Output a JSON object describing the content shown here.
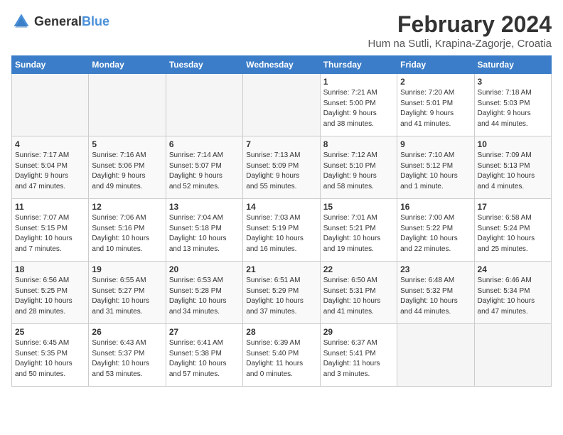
{
  "logo": {
    "general": "General",
    "blue": "Blue"
  },
  "title": "February 2024",
  "subtitle": "Hum na Sutli, Krapina-Zagorje, Croatia",
  "days_of_week": [
    "Sunday",
    "Monday",
    "Tuesday",
    "Wednesday",
    "Thursday",
    "Friday",
    "Saturday"
  ],
  "weeks": [
    [
      {
        "day": "",
        "info": ""
      },
      {
        "day": "",
        "info": ""
      },
      {
        "day": "",
        "info": ""
      },
      {
        "day": "",
        "info": ""
      },
      {
        "day": "1",
        "info": "Sunrise: 7:21 AM\nSunset: 5:00 PM\nDaylight: 9 hours\nand 38 minutes."
      },
      {
        "day": "2",
        "info": "Sunrise: 7:20 AM\nSunset: 5:01 PM\nDaylight: 9 hours\nand 41 minutes."
      },
      {
        "day": "3",
        "info": "Sunrise: 7:18 AM\nSunset: 5:03 PM\nDaylight: 9 hours\nand 44 minutes."
      }
    ],
    [
      {
        "day": "4",
        "info": "Sunrise: 7:17 AM\nSunset: 5:04 PM\nDaylight: 9 hours\nand 47 minutes."
      },
      {
        "day": "5",
        "info": "Sunrise: 7:16 AM\nSunset: 5:06 PM\nDaylight: 9 hours\nand 49 minutes."
      },
      {
        "day": "6",
        "info": "Sunrise: 7:14 AM\nSunset: 5:07 PM\nDaylight: 9 hours\nand 52 minutes."
      },
      {
        "day": "7",
        "info": "Sunrise: 7:13 AM\nSunset: 5:09 PM\nDaylight: 9 hours\nand 55 minutes."
      },
      {
        "day": "8",
        "info": "Sunrise: 7:12 AM\nSunset: 5:10 PM\nDaylight: 9 hours\nand 58 minutes."
      },
      {
        "day": "9",
        "info": "Sunrise: 7:10 AM\nSunset: 5:12 PM\nDaylight: 10 hours\nand 1 minute."
      },
      {
        "day": "10",
        "info": "Sunrise: 7:09 AM\nSunset: 5:13 PM\nDaylight: 10 hours\nand 4 minutes."
      }
    ],
    [
      {
        "day": "11",
        "info": "Sunrise: 7:07 AM\nSunset: 5:15 PM\nDaylight: 10 hours\nand 7 minutes."
      },
      {
        "day": "12",
        "info": "Sunrise: 7:06 AM\nSunset: 5:16 PM\nDaylight: 10 hours\nand 10 minutes."
      },
      {
        "day": "13",
        "info": "Sunrise: 7:04 AM\nSunset: 5:18 PM\nDaylight: 10 hours\nand 13 minutes."
      },
      {
        "day": "14",
        "info": "Sunrise: 7:03 AM\nSunset: 5:19 PM\nDaylight: 10 hours\nand 16 minutes."
      },
      {
        "day": "15",
        "info": "Sunrise: 7:01 AM\nSunset: 5:21 PM\nDaylight: 10 hours\nand 19 minutes."
      },
      {
        "day": "16",
        "info": "Sunrise: 7:00 AM\nSunset: 5:22 PM\nDaylight: 10 hours\nand 22 minutes."
      },
      {
        "day": "17",
        "info": "Sunrise: 6:58 AM\nSunset: 5:24 PM\nDaylight: 10 hours\nand 25 minutes."
      }
    ],
    [
      {
        "day": "18",
        "info": "Sunrise: 6:56 AM\nSunset: 5:25 PM\nDaylight: 10 hours\nand 28 minutes."
      },
      {
        "day": "19",
        "info": "Sunrise: 6:55 AM\nSunset: 5:27 PM\nDaylight: 10 hours\nand 31 minutes."
      },
      {
        "day": "20",
        "info": "Sunrise: 6:53 AM\nSunset: 5:28 PM\nDaylight: 10 hours\nand 34 minutes."
      },
      {
        "day": "21",
        "info": "Sunrise: 6:51 AM\nSunset: 5:29 PM\nDaylight: 10 hours\nand 37 minutes."
      },
      {
        "day": "22",
        "info": "Sunrise: 6:50 AM\nSunset: 5:31 PM\nDaylight: 10 hours\nand 41 minutes."
      },
      {
        "day": "23",
        "info": "Sunrise: 6:48 AM\nSunset: 5:32 PM\nDaylight: 10 hours\nand 44 minutes."
      },
      {
        "day": "24",
        "info": "Sunrise: 6:46 AM\nSunset: 5:34 PM\nDaylight: 10 hours\nand 47 minutes."
      }
    ],
    [
      {
        "day": "25",
        "info": "Sunrise: 6:45 AM\nSunset: 5:35 PM\nDaylight: 10 hours\nand 50 minutes."
      },
      {
        "day": "26",
        "info": "Sunrise: 6:43 AM\nSunset: 5:37 PM\nDaylight: 10 hours\nand 53 minutes."
      },
      {
        "day": "27",
        "info": "Sunrise: 6:41 AM\nSunset: 5:38 PM\nDaylight: 10 hours\nand 57 minutes."
      },
      {
        "day": "28",
        "info": "Sunrise: 6:39 AM\nSunset: 5:40 PM\nDaylight: 11 hours\nand 0 minutes."
      },
      {
        "day": "29",
        "info": "Sunrise: 6:37 AM\nSunset: 5:41 PM\nDaylight: 11 hours\nand 3 minutes."
      },
      {
        "day": "",
        "info": ""
      },
      {
        "day": "",
        "info": ""
      }
    ]
  ]
}
